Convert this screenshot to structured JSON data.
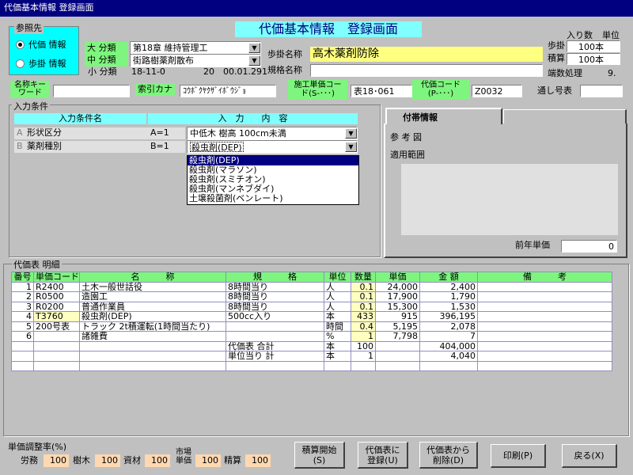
{
  "window": {
    "title": "代価基本情報 登録画面"
  },
  "header": {
    "banner": "代価基本情報　登録画面"
  },
  "ref": {
    "title": "参照先",
    "options": [
      "代価 情報",
      "歩掛 情報"
    ]
  },
  "class": {
    "dai_label": "大 分類",
    "dai_value": "第18章 維持管理工",
    "chu_label": "中 分類",
    "chu_value": "街路樹薬剤散布",
    "sho_label": "小 分類",
    "sho_code": "18-11-0",
    "sho_num": "20",
    "sho_date": "00.01.291"
  },
  "names": {
    "bukake_label": "歩掛名称",
    "bukake_value": "高木薬剤防除",
    "kikaku_label": "規格名称",
    "kikaku_value": ""
  },
  "right": {
    "iri_label": "入り数",
    "tani_label": "単位",
    "bukake_label": "歩掛",
    "bukake_value": "100本",
    "sekisan_label": "積算",
    "sekisan_value": "100本",
    "hasu_label": "端数処理",
    "hasu_value": "9."
  },
  "row3": {
    "keyword_label": "名称キーワード",
    "keyword_value": "",
    "kana_label": "索引カナ",
    "kana_value": "ｺｳﾎﾞｸﾔｸｻﾞｲﾎﾞｳｼﾞｮ",
    "sekou_label": "施工単価コード(S-･･･)",
    "sekou_value": "表18･061",
    "daika_label": "代価コード(P-･･･)",
    "daika_value": "Z0032",
    "toshi_label": "通し号表",
    "toshi_value": ""
  },
  "conditions": {
    "title": "入力条件",
    "col1": "入力条件名",
    "col2": "入　力　　内　容",
    "rows": [
      {
        "letter": "A",
        "name": "形状区分",
        "code": "A=1",
        "value": "中低木 樹高 100cm未満"
      },
      {
        "letter": "B",
        "name": "薬剤種別",
        "code": "B=1",
        "value": "殺虫剤(DEP)"
      }
    ],
    "dropdown": [
      "殺虫剤(DEP)",
      "殺虫剤(マラソン)",
      "殺虫剤(スミチオン)",
      "殺虫剤(マンネブダイ)",
      "土壌殺菌剤(ベンレート)"
    ]
  },
  "info": {
    "tab1": "付帯情報",
    "tab2": "",
    "sankozu": "参 考 図",
    "tekiyo": "適用範囲",
    "zennen_label": "前年単価",
    "zennen_value": "0"
  },
  "detail": {
    "title": "代価表 明細",
    "headers": [
      "番号",
      "単価コード",
      "名　　　称",
      "規　　　格",
      "単位",
      "数量",
      "単価",
      "金 額",
      "備　　　考"
    ],
    "rows": [
      [
        "1",
        "R2400",
        "土木一般世話役",
        "8時間当り",
        "人",
        "0.1",
        "24,000",
        "2,400",
        ""
      ],
      [
        "2",
        "R0500",
        "造園工",
        "8時間当り",
        "人",
        "0.1",
        "17,900",
        "1,790",
        ""
      ],
      [
        "3",
        "R0200",
        "普通作業員",
        "8時間当り",
        "人",
        "0.1",
        "15,300",
        "1,530",
        ""
      ],
      [
        "4",
        "T3760",
        "殺虫剤(DEP)",
        "500cc入り",
        "本",
        "433",
        "915",
        "396,195",
        ""
      ],
      [
        "5",
        "200号表",
        "トラック 2t積運転(1時間当たり)",
        "",
        "時間",
        "0.4",
        "5,195",
        "2,078",
        ""
      ],
      [
        "6",
        "",
        "諸雑費",
        "",
        "%",
        "1",
        "7,798",
        "7",
        ""
      ],
      [
        "",
        "",
        "",
        "代価表 合計",
        "本",
        "100",
        "",
        "404,000",
        ""
      ],
      [
        "",
        "",
        "",
        "単位当り 計",
        "本",
        "1",
        "",
        "4,040",
        ""
      ],
      [
        "",
        "",
        "",
        "",
        "",
        "",
        "",
        "",
        ""
      ]
    ]
  },
  "adjust": {
    "title": "単価調整率(%)",
    "items": [
      {
        "label": "労務",
        "value": "100"
      },
      {
        "label": "樹木",
        "value": "100"
      },
      {
        "label": "資材",
        "value": "100"
      },
      {
        "label": "市場単価",
        "value": "100"
      },
      {
        "label": "精算",
        "value": "100"
      }
    ]
  },
  "buttons": {
    "calc": "積算開始(S)",
    "register": "代価表に登録(U)",
    "delete": "代価表から削除(D)",
    "print": "印刷(P)",
    "back": "戻る(X)"
  }
}
